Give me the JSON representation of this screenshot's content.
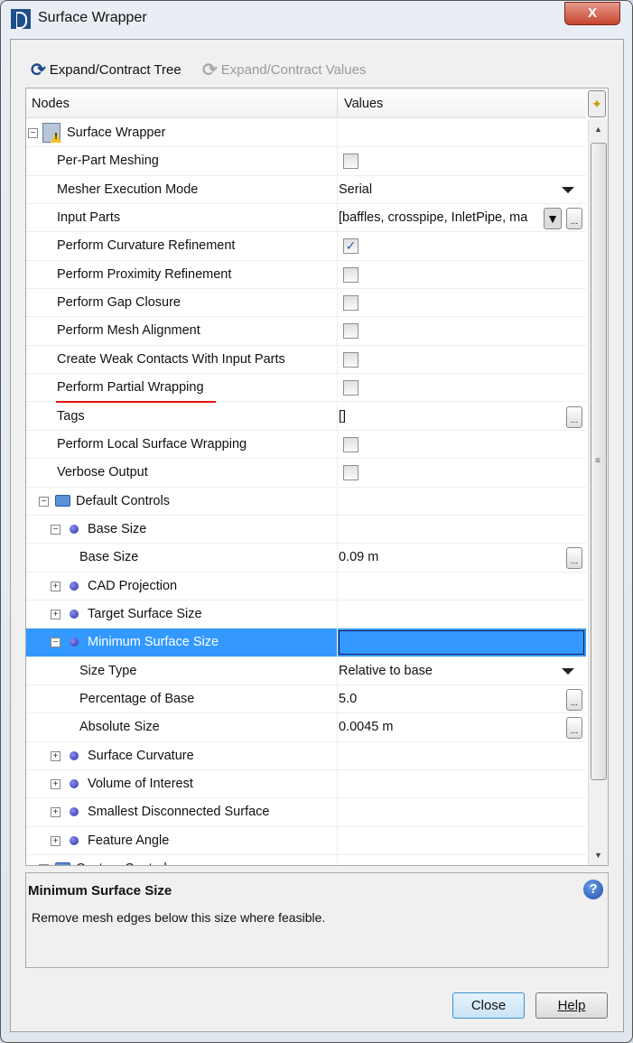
{
  "window": {
    "title": "Surface Wrapper",
    "close": "X"
  },
  "toolbar": {
    "expand_tree": "Expand/Contract Tree",
    "expand_values": "Expand/Contract Values"
  },
  "table": {
    "col_nodes": "Nodes",
    "col_values": "Values",
    "rows": [
      {
        "label": "Surface Wrapper",
        "level": 0,
        "expander": "minus",
        "icon": "surface-wrapper"
      },
      {
        "label": "Per-Part Meshing",
        "level": 1,
        "value_type": "checkbox",
        "checked": false
      },
      {
        "label": "Mesher Execution Mode",
        "level": 1,
        "value": "Serial",
        "value_type": "dropdown"
      },
      {
        "label": "Input Parts",
        "level": 1,
        "value": "[baffles, crosspipe, InletPipe, ma",
        "value_type": "filter-ellipsis"
      },
      {
        "label": "Perform Curvature Refinement",
        "level": 1,
        "value_type": "checkbox",
        "checked": true
      },
      {
        "label": "Perform Proximity Refinement",
        "level": 1,
        "value_type": "checkbox",
        "checked": false
      },
      {
        "label": "Perform Gap Closure",
        "level": 1,
        "value_type": "checkbox",
        "checked": false
      },
      {
        "label": "Perform Mesh Alignment",
        "level": 1,
        "value_type": "checkbox",
        "checked": false
      },
      {
        "label": "Create Weak Contacts With Input Parts",
        "level": 1,
        "value_type": "checkbox",
        "checked": false
      },
      {
        "label": "Perform Partial Wrapping",
        "level": 1,
        "value_type": "checkbox",
        "checked": false,
        "underlined": true
      },
      {
        "label": "Tags",
        "level": 1,
        "value": "[]",
        "value_type": "ellipsis"
      },
      {
        "label": "Perform Local Surface Wrapping",
        "level": 1,
        "value_type": "checkbox",
        "checked": false
      },
      {
        "label": "Verbose Output",
        "level": 1,
        "value_type": "checkbox",
        "checked": false
      },
      {
        "label": "Default Controls",
        "level": 1,
        "expander": "minus",
        "icon": "folder"
      },
      {
        "label": "Base Size",
        "level": 2,
        "expander": "minus",
        "icon": "dot"
      },
      {
        "label": "Base Size",
        "level": 3,
        "value": "0.09 m",
        "value_type": "ellipsis"
      },
      {
        "label": "CAD Projection",
        "level": 2,
        "expander": "plus",
        "icon": "dot"
      },
      {
        "label": "Target Surface Size",
        "level": 2,
        "expander": "plus",
        "icon": "dot"
      },
      {
        "label": "Minimum Surface Size",
        "level": 2,
        "expander": "minus",
        "icon": "dot",
        "selected": true
      },
      {
        "label": "Size Type",
        "level": 3,
        "value": "Relative to base",
        "value_type": "dropdown"
      },
      {
        "label": "Percentage of Base",
        "level": 3,
        "value": "5.0",
        "value_type": "ellipsis"
      },
      {
        "label": "Absolute Size",
        "level": 3,
        "value": "0.0045 m",
        "value_type": "ellipsis"
      },
      {
        "label": "Surface Curvature",
        "level": 2,
        "expander": "plus",
        "icon": "dot"
      },
      {
        "label": "Volume of Interest",
        "level": 2,
        "expander": "plus",
        "icon": "dot"
      },
      {
        "label": "Smallest Disconnected Surface",
        "level": 2,
        "expander": "plus",
        "icon": "dot"
      },
      {
        "label": "Feature Angle",
        "level": 2,
        "expander": "plus",
        "icon": "dot"
      },
      {
        "label": "Custom Controls",
        "level": 1,
        "expander": "plus",
        "icon": "folder"
      }
    ]
  },
  "description": {
    "title": "Minimum Surface Size",
    "text": "Remove mesh edges below this size where feasible."
  },
  "buttons": {
    "close": "Close",
    "help": "Help"
  },
  "colors": {
    "selection": "#3399ff",
    "underline": "#e01010"
  }
}
